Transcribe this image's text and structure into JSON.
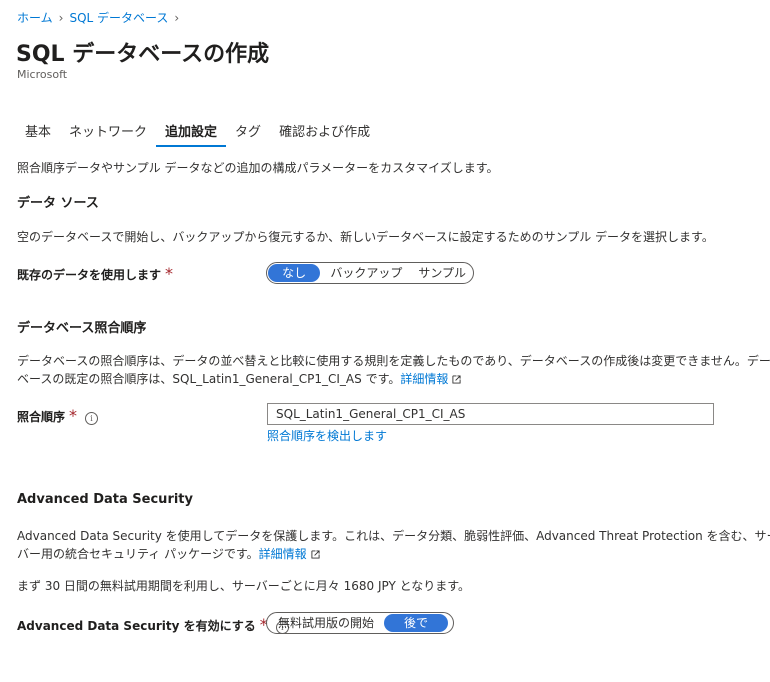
{
  "breadcrumb": {
    "home": "ホーム",
    "sqldb": "SQL データベース"
  },
  "page": {
    "title": "SQL データベースの作成",
    "publisher": "Microsoft"
  },
  "tabs": [
    "基本",
    "ネットワーク",
    "追加設定",
    "タグ",
    "確認および作成"
  ],
  "active_tab": "追加設定",
  "intro": "照合順序データやサンプル データなどの追加の構成パラメーターをカスタマイズします。",
  "data_source": {
    "heading": "データ ソース",
    "description": "空のデータベースで開始し、バックアップから復元するか、新しいデータベースに設定するためのサンプル データを選択します。",
    "label": "既存のデータを使用します",
    "options": [
      "なし",
      "バックアップ",
      "サンプル"
    ],
    "selected": "なし"
  },
  "collation": {
    "heading": "データベース照合順序",
    "description_line1": "データベースの照合順序は、データの並べ替えと比較に使用する規則を定義したものであり、データベースの作成後は変更できません。データ",
    "description_line2": "ベースの既定の照合順序は、SQL_Latin1_General_CP1_CI_AS です。",
    "learn_more": "詳細情報",
    "label": "照合順序",
    "value": "SQL_Latin1_General_CP1_CI_AS",
    "find_link": "照合順序を検出します"
  },
  "ads": {
    "heading": "Advanced Data Security",
    "description_line1": "Advanced Data Security を使用してデータを保護します。これは、データ分類、脆弱性評価、Advanced Threat Protection を含む、サー",
    "description_line2": "バー用の統合セキュリティ パッケージです。",
    "learn_more": "詳細情報",
    "trial_text": "まず 30 日間の無料試用期間を利用し、サーバーごとに月々 1680 JPY となります。",
    "label": "Advanced Data Security を有効にする",
    "options": [
      "無料試用版の開始",
      "後で"
    ],
    "selected": "後で"
  },
  "icons": {
    "required": "*",
    "info": "info-icon",
    "external": "external-link-icon",
    "chevron": "chevron-right-icon"
  },
  "colors": {
    "accent": "#0078d4",
    "toggle_on": "#3275d7",
    "required": "#a4262c"
  }
}
